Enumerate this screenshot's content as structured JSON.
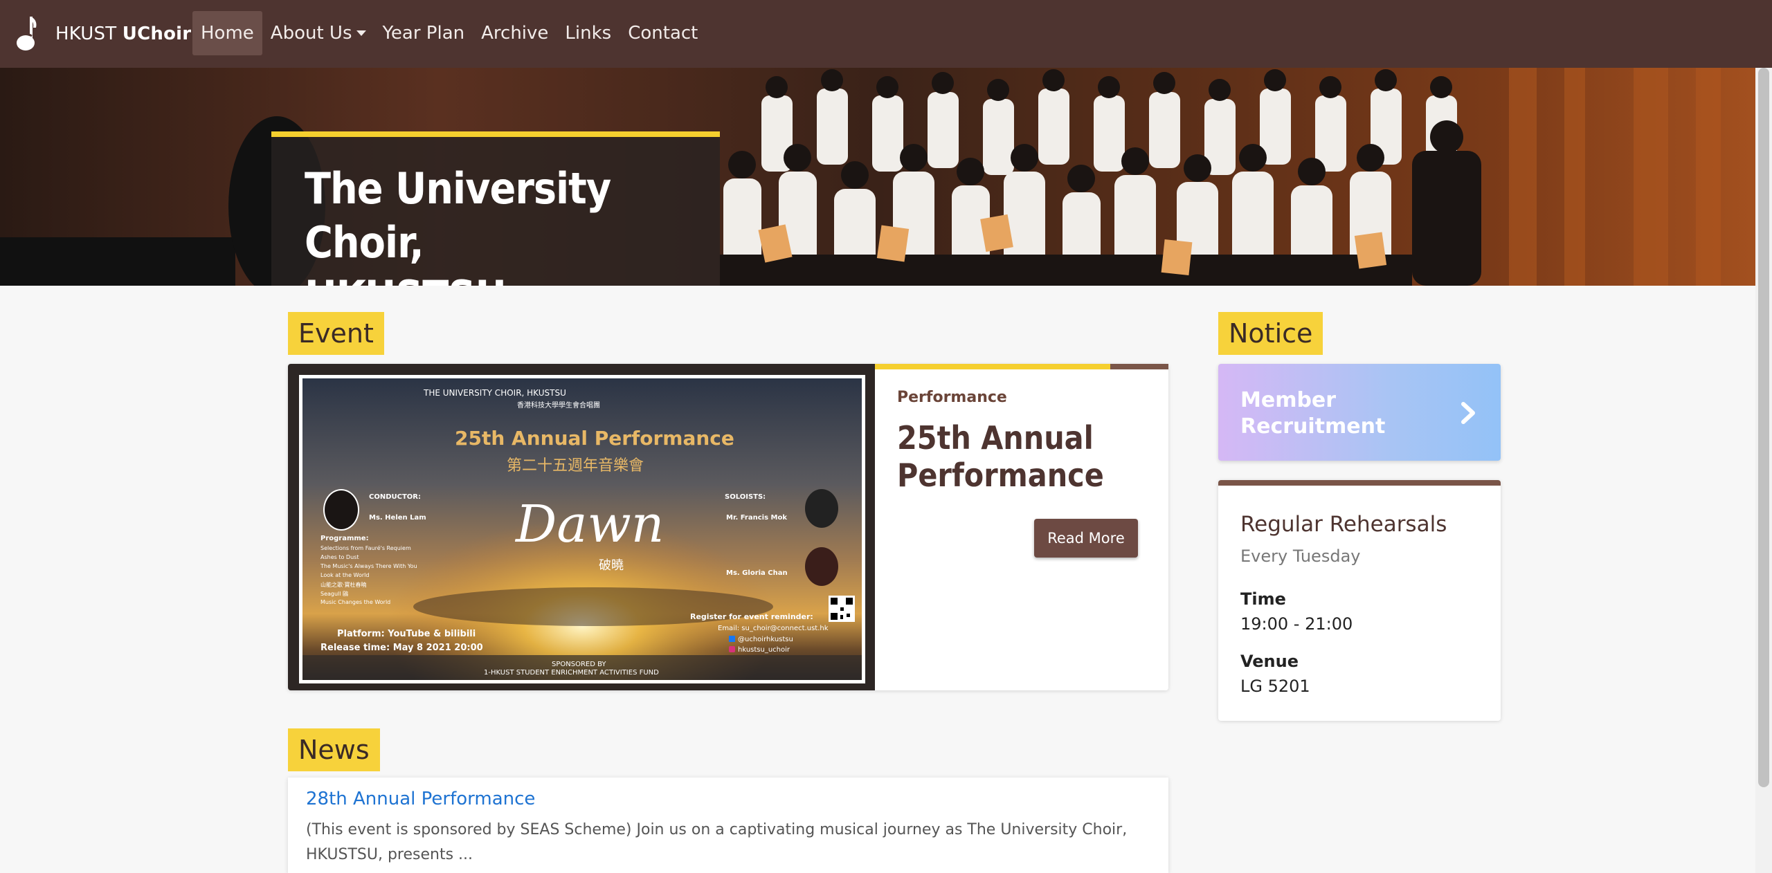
{
  "navbar": {
    "brand_prefix": "HKUST",
    "brand_strong": "UChoir",
    "items": [
      {
        "label": "Home",
        "active": true
      },
      {
        "label": "About Us",
        "dropdown": true
      },
      {
        "label": "Year Plan"
      },
      {
        "label": "Archive"
      },
      {
        "label": "Links"
      },
      {
        "label": "Contact"
      }
    ]
  },
  "hero": {
    "title_line1": "The University Choir,",
    "title_line2": "HKUSTSU"
  },
  "sections": {
    "event": "Event",
    "notice": "Notice",
    "news": "News"
  },
  "event": {
    "category": "Performance",
    "title": "25th Annual Performance",
    "read_more": "Read More",
    "poster": {
      "org_en": "THE UNIVERSITY CHOIR, HKUSTSU",
      "org_zh": "香港科技大學學生會合唱團",
      "title_en": "25th Annual  Performance",
      "title_zh": "第二十五週年音樂會",
      "conductor_label": "CONDUCTOR:",
      "conductor": "Ms. Helen Lam",
      "soloists_label": "SOLOISTS:",
      "soloist1": "Mr. Francis Mok",
      "soloist2": "Ms. Gloria Chan",
      "programme_label": "Programme:",
      "programme": [
        "Selections from Fauré's Requiem",
        "Ashes to Dust",
        "The Music's Always There With You",
        "Look at the World",
        "山能之歌·寶杜春曉",
        "Seagull 鷗",
        "Music Changes the World"
      ],
      "dawn": "Dawn",
      "dawn_zh": "破曉",
      "platform": "Platform: YouTube & bilibili",
      "release": "Release time: May 8 2021  20:00",
      "register": "Register for event reminder:",
      "email": "Email: su_choir@connect.ust.hk",
      "facebook": "@uchoirhkustsu",
      "instagram": "hkustsu_uchoir",
      "sponsored_by": "SPONSORED BY",
      "sponsor": "1-HKUST STUDENT ENRICHMENT ACTIVITIES FUND"
    }
  },
  "notice": {
    "recruit_line1": "Member",
    "recruit_line2": "Recruitment",
    "rehearsal_title": "Regular Rehearsals",
    "rehearsal_sub": "Every Tuesday",
    "time_label": "Time",
    "time_value": "19:00 - 21:00",
    "venue_label": "Venue",
    "venue_value": "LG 5201"
  },
  "news": {
    "title": "28th Annual Performance",
    "body": "(This event is sponsored by SEAS Scheme) Join us on a captivating musical journey as The University Choir, HKUSTSU, presents ..."
  },
  "colors": {
    "navbar": "#4e3430",
    "accent_yellow": "#f5cf2e",
    "brown_button": "#6d4a43",
    "link_blue": "#1e73d2"
  }
}
